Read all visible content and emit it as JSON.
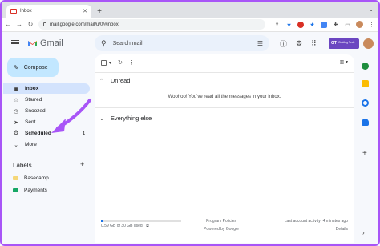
{
  "browser": {
    "tab_title": "Inbox",
    "url": "mail.google.com/mail/u/0/#inbox"
  },
  "header": {
    "app_name": "Gmail",
    "search_placeholder": "Search mail",
    "badge_logo": "GT",
    "badge_text": "Guiding Tech"
  },
  "sidebar": {
    "compose_label": "Compose",
    "items": [
      {
        "label": "Inbox",
        "icon": "inbox-icon",
        "count": ""
      },
      {
        "label": "Starred",
        "icon": "star-icon",
        "count": ""
      },
      {
        "label": "Snoozed",
        "icon": "clock-icon",
        "count": ""
      },
      {
        "label": "Sent",
        "icon": "send-icon",
        "count": ""
      },
      {
        "label": "Scheduled",
        "icon": "scheduled-icon",
        "count": "1"
      },
      {
        "label": "More",
        "icon": "chevron-down-icon",
        "count": ""
      }
    ],
    "labels_title": "Labels",
    "labels": [
      {
        "label": "Basecamp",
        "color": "#f5d778"
      },
      {
        "label": "Payments",
        "color": "#16a765"
      }
    ]
  },
  "main": {
    "unread_title": "Unread",
    "empty_message": "Woohoo! You've read all the messages in your inbox.",
    "everything_else_title": "Everything else",
    "footer": {
      "storage": "0.59 GB of 30 GB used",
      "storage_fraction": 0.02,
      "program_policies": "Program Policies",
      "powered_by": "Powered by Google",
      "last_activity": "Last account activity: 4 minutes ago",
      "details": "Details"
    }
  },
  "colors": {
    "accent": "#a855f7",
    "compose_bg": "#c2e7ff",
    "active_nav_bg": "#d3e3fd"
  }
}
